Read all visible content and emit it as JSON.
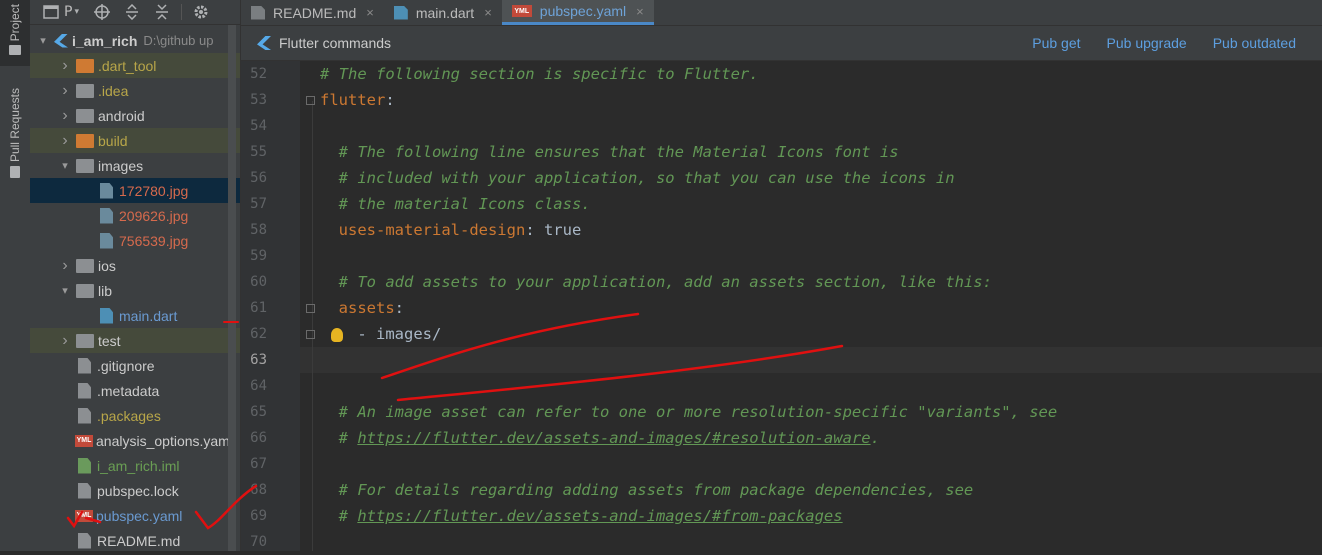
{
  "sidebar": {
    "project_label": "Project",
    "pull_requests_label": "Pull Requests",
    "project_toolbar_short": "P"
  },
  "tree": {
    "root": {
      "name": "i_am_rich",
      "path": "D:\\github up"
    },
    "items": [
      {
        "label": ".dart_tool",
        "kind": "folder-orange",
        "expandable": true,
        "expanded": false,
        "color": "olive",
        "indent": 1,
        "style": "excl"
      },
      {
        "label": ".idea",
        "kind": "folder",
        "expandable": true,
        "expanded": false,
        "color": "olive",
        "indent": 1
      },
      {
        "label": "android",
        "kind": "folder",
        "expandable": true,
        "expanded": false,
        "color": "white",
        "indent": 1
      },
      {
        "label": "build",
        "kind": "folder-orange",
        "expandable": true,
        "expanded": false,
        "color": "olive",
        "indent": 1,
        "style": "excl"
      },
      {
        "label": "images",
        "kind": "folder",
        "expandable": true,
        "expanded": true,
        "color": "white",
        "indent": 1
      },
      {
        "label": "172780.jpg",
        "kind": "file-img",
        "color": "red",
        "indent": 2,
        "style": "sel"
      },
      {
        "label": "209626.jpg",
        "kind": "file-img",
        "color": "red",
        "indent": 2
      },
      {
        "label": "756539.jpg",
        "kind": "file-img",
        "color": "red",
        "indent": 2
      },
      {
        "label": "ios",
        "kind": "folder",
        "expandable": true,
        "expanded": false,
        "color": "white",
        "indent": 1
      },
      {
        "label": "lib",
        "kind": "folder",
        "expandable": true,
        "expanded": true,
        "color": "white",
        "indent": 1
      },
      {
        "label": "main.dart",
        "kind": "file-dart",
        "color": "blue",
        "indent": 2
      },
      {
        "label": "test",
        "kind": "folder",
        "expandable": true,
        "expanded": false,
        "color": "white",
        "indent": 1,
        "style": "excl"
      },
      {
        "label": ".gitignore",
        "kind": "file",
        "color": "white",
        "indent": 1
      },
      {
        "label": ".metadata",
        "kind": "file",
        "color": "white",
        "indent": 1
      },
      {
        "label": ".packages",
        "kind": "file",
        "color": "olive",
        "indent": 1
      },
      {
        "label": "analysis_options.yaml",
        "kind": "file-yml",
        "color": "white",
        "indent": 1
      },
      {
        "label": "i_am_rich.iml",
        "kind": "file-iml",
        "color": "green",
        "indent": 1
      },
      {
        "label": "pubspec.lock",
        "kind": "file",
        "color": "white",
        "indent": 1
      },
      {
        "label": "pubspec.yaml",
        "kind": "file-yml",
        "color": "blue",
        "indent": 1
      },
      {
        "label": "README.md",
        "kind": "file",
        "color": "white",
        "indent": 1
      }
    ]
  },
  "tabs": [
    {
      "label": "README.md",
      "icon": "markdown-file-icon",
      "active": false
    },
    {
      "label": "main.dart",
      "icon": "dart-file-icon",
      "active": false
    },
    {
      "label": "pubspec.yaml",
      "icon": "yaml-file-icon",
      "active": true
    }
  ],
  "yml_badge": "YML",
  "flutter_bar": {
    "title": "Flutter commands",
    "actions": [
      "Pub get",
      "Pub upgrade",
      "Pub outdated"
    ]
  },
  "editor": {
    "current_line": 63,
    "lines": [
      {
        "n": 52,
        "parts": [
          [
            "cmt",
            "# The following section is specific to Flutter."
          ]
        ]
      },
      {
        "n": 53,
        "parts": [
          [
            "key",
            "flutter"
          ],
          [
            "plain",
            ":"
          ]
        ]
      },
      {
        "n": 54,
        "parts": []
      },
      {
        "n": 55,
        "parts": [
          [
            "plain",
            "  "
          ],
          [
            "cmt",
            "# The following line ensures that the Material Icons font is"
          ]
        ]
      },
      {
        "n": 56,
        "parts": [
          [
            "plain",
            "  "
          ],
          [
            "cmt",
            "# included with your application, so that you can use the icons in"
          ]
        ]
      },
      {
        "n": 57,
        "parts": [
          [
            "plain",
            "  "
          ],
          [
            "cmt",
            "# the material Icons class."
          ]
        ]
      },
      {
        "n": 58,
        "parts": [
          [
            "plain",
            "  "
          ],
          [
            "key",
            "uses-material-design"
          ],
          [
            "plain",
            ": true"
          ]
        ]
      },
      {
        "n": 59,
        "parts": []
      },
      {
        "n": 60,
        "parts": [
          [
            "plain",
            "  "
          ],
          [
            "cmt",
            "# To add assets to your application, add an assets section, like this:"
          ]
        ]
      },
      {
        "n": 61,
        "parts": [
          [
            "plain",
            "  "
          ],
          [
            "key",
            "assets"
          ],
          [
            "plain",
            ":"
          ]
        ]
      },
      {
        "n": 62,
        "parts": [
          [
            "plain",
            "    - images/"
          ]
        ]
      },
      {
        "n": 63,
        "parts": []
      },
      {
        "n": 64,
        "parts": []
      },
      {
        "n": 65,
        "parts": [
          [
            "plain",
            "  "
          ],
          [
            "cmt",
            "# An image asset can refer to one or more resolution-specific \"variants\", see"
          ]
        ]
      },
      {
        "n": 66,
        "parts": [
          [
            "plain",
            "  "
          ],
          [
            "cmt",
            "# "
          ],
          [
            "link",
            "https://flutter.dev/assets-and-images/#resolution-aware"
          ],
          [
            "cmt",
            "."
          ]
        ]
      },
      {
        "n": 67,
        "parts": []
      },
      {
        "n": 68,
        "parts": [
          [
            "plain",
            "  "
          ],
          [
            "cmt",
            "# For details regarding adding assets from package dependencies, see"
          ]
        ]
      },
      {
        "n": 69,
        "parts": [
          [
            "plain",
            "  "
          ],
          [
            "cmt",
            "# "
          ],
          [
            "link",
            "https://flutter.dev/assets-and-images/#from-packages"
          ]
        ]
      },
      {
        "n": 70,
        "parts": []
      }
    ]
  },
  "colors": {
    "editor_bg": "#2b2b2b",
    "comment": "#629755",
    "key": "#cc7832",
    "text": "#a9b7c6",
    "annotation_red": "#e01010",
    "accent_link": "#5d9fe0"
  }
}
